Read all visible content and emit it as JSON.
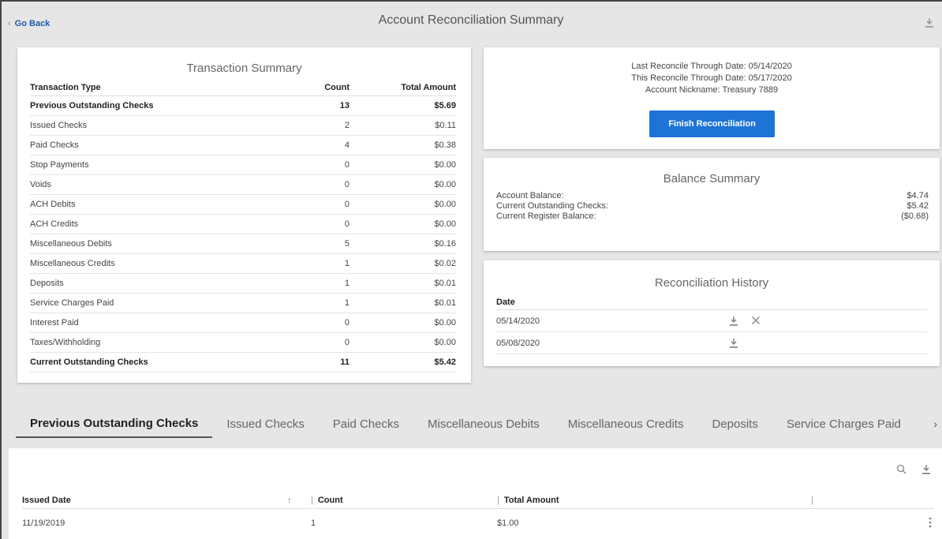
{
  "header": {
    "back_label": "Go Back",
    "title": "Account Reconciliation Summary",
    "download_icon": "download-icon"
  },
  "transaction_summary": {
    "title": "Transaction Summary",
    "columns": [
      "Transaction Type",
      "Count",
      "Total Amount"
    ],
    "rows": [
      {
        "type": "Previous Outstanding Checks",
        "count": "13",
        "amount": "$5.69",
        "bold": true
      },
      {
        "type": "Issued Checks",
        "count": "2",
        "amount": "$0.11"
      },
      {
        "type": "Paid Checks",
        "count": "4",
        "amount": "$0.38"
      },
      {
        "type": "Stop Payments",
        "count": "0",
        "amount": "$0.00"
      },
      {
        "type": "Voids",
        "count": "0",
        "amount": "$0.00"
      },
      {
        "type": "ACH Debits",
        "count": "0",
        "amount": "$0.00"
      },
      {
        "type": "ACH Credits",
        "count": "0",
        "amount": "$0.00"
      },
      {
        "type": "Miscellaneous Debits",
        "count": "5",
        "amount": "$0.16"
      },
      {
        "type": "Miscellaneous Credits",
        "count": "1",
        "amount": "$0.02"
      },
      {
        "type": "Deposits",
        "count": "1",
        "amount": "$0.01"
      },
      {
        "type": "Service Charges Paid",
        "count": "1",
        "amount": "$0.01"
      },
      {
        "type": "Interest Paid",
        "count": "0",
        "amount": "$0.00"
      },
      {
        "type": "Taxes/Withholding",
        "count": "0",
        "amount": "$0.00"
      },
      {
        "type": "Current Outstanding Checks",
        "count": "11",
        "amount": "$5.42",
        "bold": true
      }
    ]
  },
  "reconcile_info": {
    "last_through": "Last Reconcile Through Date: 05/14/2020",
    "this_through": "This Reconcile Through Date: 05/17/2020",
    "nickname": "Account Nickname: Treasury 7889",
    "finish_button": "Finish Reconciliation",
    "button_color": "#1e73d6"
  },
  "balance_summary": {
    "title": "Balance Summary",
    "rows": [
      {
        "label": "Account Balance:",
        "value": "$4.74"
      },
      {
        "label": "Current Outstanding Checks:",
        "value": "$5.42"
      },
      {
        "label": "Current Register Balance:",
        "value": "($0.68)"
      }
    ]
  },
  "reconciliation_history": {
    "title": "Reconciliation History",
    "date_header": "Date",
    "rows": [
      {
        "date": "05/14/2020",
        "icons": [
          "download-icon",
          "close-icon"
        ]
      },
      {
        "date": "05/08/2020",
        "icons": [
          "download-icon"
        ]
      }
    ]
  },
  "tabs": [
    {
      "label": "Previous Outstanding Checks",
      "active": true
    },
    {
      "label": "Issued Checks"
    },
    {
      "label": "Paid Checks"
    },
    {
      "label": "Miscellaneous Debits"
    },
    {
      "label": "Miscellaneous Credits"
    },
    {
      "label": "Deposits"
    },
    {
      "label": "Service Charges Paid"
    }
  ],
  "tab_next_icon": "chevron-right-icon",
  "detail_table": {
    "columns": {
      "issued_date": "Issued Date",
      "count": "Count",
      "total_amount": "Total Amount"
    },
    "sort_icon": "sort-ascending-icon",
    "tool_icons": [
      "search-icon",
      "download-icon"
    ],
    "rows": [
      {
        "issued_date": "11/19/2019",
        "count": "1",
        "total_amount": "$1.00"
      }
    ]
  }
}
